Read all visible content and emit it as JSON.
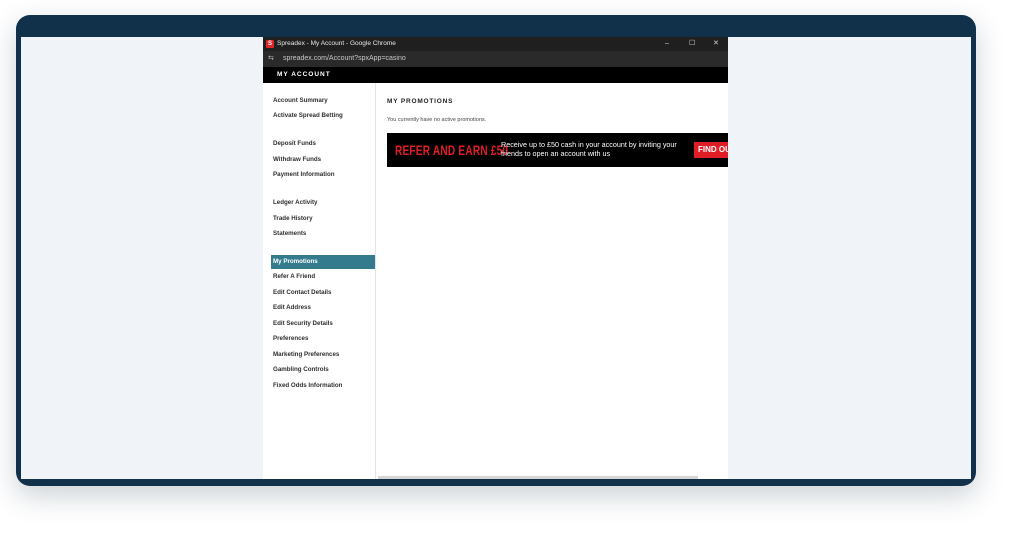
{
  "window": {
    "title": "Spreadex - My Account - Google Chrome",
    "favicon_letter": "S",
    "controls": [
      "–",
      "☐",
      "✕"
    ]
  },
  "urlbar": {
    "url": "spreadex.com/Account?spxApp=casino",
    "icon": "tune-icon"
  },
  "header": {
    "title": "MY ACCOUNT"
  },
  "sidebar": {
    "groups": [
      [
        "Account Summary",
        "Activate Spread Betting"
      ],
      [
        "Deposit Funds",
        "Withdraw Funds",
        "Payment Information"
      ],
      [
        "Ledger Activity",
        "Trade History",
        "Statements"
      ],
      [
        "My Promotions",
        "Refer A Friend",
        "Edit Contact Details",
        "Edit Address",
        "Edit Security Details",
        "Preferences",
        "Marketing Preferences",
        "Gambling Controls",
        "Fixed Odds Information"
      ]
    ],
    "active": "My Promotions"
  },
  "main": {
    "heading": "MY PROMOTIONS",
    "empty_message": "You currently have no active promotions.",
    "banner": {
      "headline": "REFER AND EARN £50",
      "text": "Receive up to £50 cash in your account by inviting your friends to open an account with us",
      "cta": "FIND OUT"
    }
  },
  "colors": {
    "frame": "#11304a",
    "active_nav": "#347b8d",
    "brand_red": "#e11d26"
  }
}
